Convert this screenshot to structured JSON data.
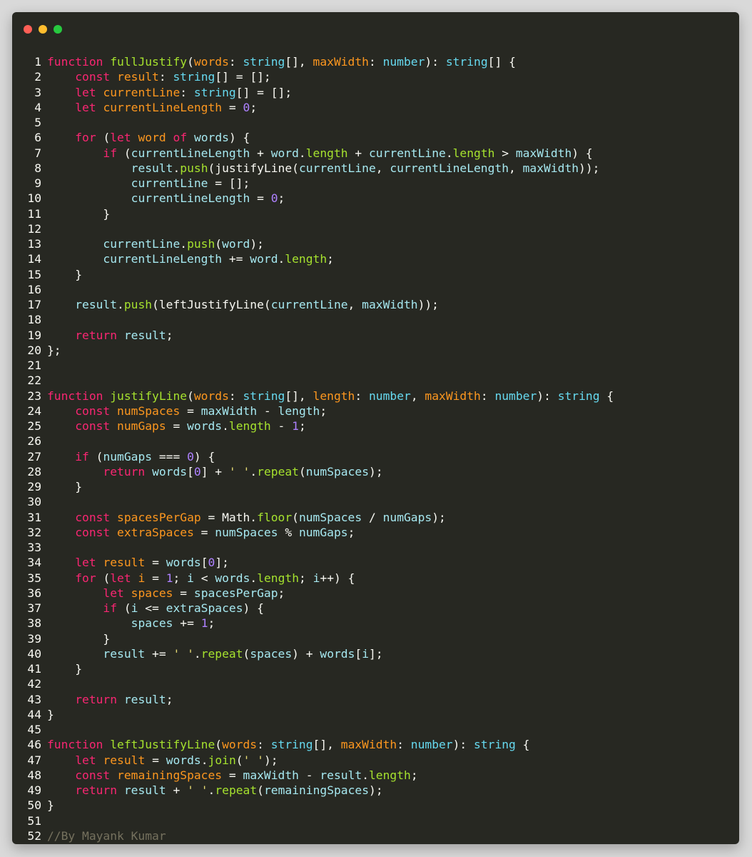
{
  "window": {
    "controls": {
      "close_color": "#ff5f56",
      "minimize_color": "#ffbd2e",
      "maximize_color": "#27c93f"
    }
  },
  "code": {
    "language": "typescript",
    "lines": [
      {
        "n": "1",
        "tokens": [
          [
            "function",
            "k"
          ],
          [
            " "
          ],
          [
            "fullJustify",
            "fn"
          ],
          [
            "("
          ],
          [
            "words",
            "p"
          ],
          [
            ": "
          ],
          [
            "string",
            "t"
          ],
          [
            "[], "
          ],
          [
            "maxWidth",
            "p"
          ],
          [
            ": "
          ],
          [
            "number",
            "t"
          ],
          [
            "): "
          ],
          [
            "string",
            "t"
          ],
          [
            "[] {"
          ]
        ]
      },
      {
        "n": "2",
        "tokens": [
          [
            "    "
          ],
          [
            "const",
            "k"
          ],
          [
            " "
          ],
          [
            "result",
            "p"
          ],
          [
            ": "
          ],
          [
            "string",
            "t"
          ],
          [
            "[] = [];"
          ]
        ]
      },
      {
        "n": "3",
        "tokens": [
          [
            "    "
          ],
          [
            "let",
            "k"
          ],
          [
            " "
          ],
          [
            "currentLine",
            "p"
          ],
          [
            ": "
          ],
          [
            "string",
            "t"
          ],
          [
            "[] = [];"
          ]
        ]
      },
      {
        "n": "4",
        "tokens": [
          [
            "    "
          ],
          [
            "let",
            "k"
          ],
          [
            " "
          ],
          [
            "currentLineLength",
            "p"
          ],
          [
            " = "
          ],
          [
            "0",
            "n"
          ],
          [
            ";"
          ]
        ]
      },
      {
        "n": "5",
        "tokens": []
      },
      {
        "n": "6",
        "tokens": [
          [
            "    "
          ],
          [
            "for",
            "k"
          ],
          [
            " ("
          ],
          [
            "let",
            "k"
          ],
          [
            " "
          ],
          [
            "word",
            "p"
          ],
          [
            " "
          ],
          [
            "of",
            "k"
          ],
          [
            " "
          ],
          [
            "words",
            "v"
          ],
          [
            ") {"
          ]
        ]
      },
      {
        "n": "7",
        "tokens": [
          [
            "        "
          ],
          [
            "if",
            "k"
          ],
          [
            " ("
          ],
          [
            "currentLineLength",
            "v"
          ],
          [
            " + "
          ],
          [
            "word",
            "v"
          ],
          [
            "."
          ],
          [
            "length",
            "fn"
          ],
          [
            " + "
          ],
          [
            "currentLine",
            "v"
          ],
          [
            "."
          ],
          [
            "length",
            "fn"
          ],
          [
            " > "
          ],
          [
            "maxWidth",
            "v"
          ],
          [
            ") {"
          ]
        ]
      },
      {
        "n": "8",
        "tokens": [
          [
            "            "
          ],
          [
            "result",
            "v"
          ],
          [
            "."
          ],
          [
            "push",
            "fn"
          ],
          [
            "(justifyLine("
          ],
          [
            "currentLine",
            "v"
          ],
          [
            ", "
          ],
          [
            "currentLineLength",
            "v"
          ],
          [
            ", "
          ],
          [
            "maxWidth",
            "v"
          ],
          [
            "));"
          ]
        ]
      },
      {
        "n": "9",
        "tokens": [
          [
            "            "
          ],
          [
            "currentLine",
            "v"
          ],
          [
            " = [];"
          ]
        ]
      },
      {
        "n": "10",
        "tokens": [
          [
            "            "
          ],
          [
            "currentLineLength",
            "v"
          ],
          [
            " = "
          ],
          [
            "0",
            "n"
          ],
          [
            ";"
          ]
        ]
      },
      {
        "n": "11",
        "tokens": [
          [
            "        }"
          ]
        ]
      },
      {
        "n": "12",
        "tokens": []
      },
      {
        "n": "13",
        "tokens": [
          [
            "        "
          ],
          [
            "currentLine",
            "v"
          ],
          [
            "."
          ],
          [
            "push",
            "fn"
          ],
          [
            "("
          ],
          [
            "word",
            "v"
          ],
          [
            ");"
          ]
        ]
      },
      {
        "n": "14",
        "tokens": [
          [
            "        "
          ],
          [
            "currentLineLength",
            "v"
          ],
          [
            " += "
          ],
          [
            "word",
            "v"
          ],
          [
            "."
          ],
          [
            "length",
            "fn"
          ],
          [
            ";"
          ]
        ]
      },
      {
        "n": "15",
        "tokens": [
          [
            "    }"
          ]
        ]
      },
      {
        "n": "16",
        "tokens": []
      },
      {
        "n": "17",
        "tokens": [
          [
            "    "
          ],
          [
            "result",
            "v"
          ],
          [
            "."
          ],
          [
            "push",
            "fn"
          ],
          [
            "(leftJustifyLine("
          ],
          [
            "currentLine",
            "v"
          ],
          [
            ", "
          ],
          [
            "maxWidth",
            "v"
          ],
          [
            "));"
          ]
        ]
      },
      {
        "n": "18",
        "tokens": []
      },
      {
        "n": "19",
        "tokens": [
          [
            "    "
          ],
          [
            "return",
            "k"
          ],
          [
            " "
          ],
          [
            "result",
            "v"
          ],
          [
            ";"
          ]
        ]
      },
      {
        "n": "20",
        "tokens": [
          [
            "};"
          ]
        ]
      },
      {
        "n": "21",
        "tokens": []
      },
      {
        "n": "22",
        "tokens": []
      },
      {
        "n": "23",
        "tokens": [
          [
            "function",
            "k"
          ],
          [
            " "
          ],
          [
            "justifyLine",
            "fn"
          ],
          [
            "("
          ],
          [
            "words",
            "p"
          ],
          [
            ": "
          ],
          [
            "string",
            "t"
          ],
          [
            "[], "
          ],
          [
            "length",
            "p"
          ],
          [
            ": "
          ],
          [
            "number",
            "t"
          ],
          [
            ", "
          ],
          [
            "maxWidth",
            "p"
          ],
          [
            ": "
          ],
          [
            "number",
            "t"
          ],
          [
            "): "
          ],
          [
            "string",
            "t"
          ],
          [
            " {"
          ]
        ]
      },
      {
        "n": "24",
        "tokens": [
          [
            "    "
          ],
          [
            "const",
            "k"
          ],
          [
            " "
          ],
          [
            "numSpaces",
            "p"
          ],
          [
            " = "
          ],
          [
            "maxWidth",
            "v"
          ],
          [
            " - "
          ],
          [
            "length",
            "v"
          ],
          [
            ";"
          ]
        ]
      },
      {
        "n": "25",
        "tokens": [
          [
            "    "
          ],
          [
            "const",
            "k"
          ],
          [
            " "
          ],
          [
            "numGaps",
            "p"
          ],
          [
            " = "
          ],
          [
            "words",
            "v"
          ],
          [
            "."
          ],
          [
            "length",
            "fn"
          ],
          [
            " - "
          ],
          [
            "1",
            "n"
          ],
          [
            ";"
          ]
        ]
      },
      {
        "n": "26",
        "tokens": []
      },
      {
        "n": "27",
        "tokens": [
          [
            "    "
          ],
          [
            "if",
            "k"
          ],
          [
            " ("
          ],
          [
            "numGaps",
            "v"
          ],
          [
            " === "
          ],
          [
            "0",
            "n"
          ],
          [
            ") {"
          ]
        ]
      },
      {
        "n": "28",
        "tokens": [
          [
            "        "
          ],
          [
            "return",
            "k"
          ],
          [
            " "
          ],
          [
            "words",
            "v"
          ],
          [
            "["
          ],
          [
            "0",
            "n"
          ],
          [
            "] + "
          ],
          [
            "' '",
            "s"
          ],
          [
            "."
          ],
          [
            "repeat",
            "fn"
          ],
          [
            "("
          ],
          [
            "numSpaces",
            "v"
          ],
          [
            ");"
          ]
        ]
      },
      {
        "n": "29",
        "tokens": [
          [
            "    }"
          ]
        ]
      },
      {
        "n": "30",
        "tokens": []
      },
      {
        "n": "31",
        "tokens": [
          [
            "    "
          ],
          [
            "const",
            "k"
          ],
          [
            " "
          ],
          [
            "spacesPerGap",
            "p"
          ],
          [
            " = Math."
          ],
          [
            "floor",
            "fn"
          ],
          [
            "("
          ],
          [
            "numSpaces",
            "v"
          ],
          [
            " / "
          ],
          [
            "numGaps",
            "v"
          ],
          [
            ");"
          ]
        ]
      },
      {
        "n": "32",
        "tokens": [
          [
            "    "
          ],
          [
            "const",
            "k"
          ],
          [
            " "
          ],
          [
            "extraSpaces",
            "p"
          ],
          [
            " = "
          ],
          [
            "numSpaces",
            "v"
          ],
          [
            " % "
          ],
          [
            "numGaps",
            "v"
          ],
          [
            ";"
          ]
        ]
      },
      {
        "n": "33",
        "tokens": []
      },
      {
        "n": "34",
        "tokens": [
          [
            "    "
          ],
          [
            "let",
            "k"
          ],
          [
            " "
          ],
          [
            "result",
            "p"
          ],
          [
            " = "
          ],
          [
            "words",
            "v"
          ],
          [
            "["
          ],
          [
            "0",
            "n"
          ],
          [
            "];"
          ]
        ]
      },
      {
        "n": "35",
        "tokens": [
          [
            "    "
          ],
          [
            "for",
            "k"
          ],
          [
            " ("
          ],
          [
            "let",
            "k"
          ],
          [
            " "
          ],
          [
            "i",
            "p"
          ],
          [
            " = "
          ],
          [
            "1",
            "n"
          ],
          [
            "; "
          ],
          [
            "i",
            "v"
          ],
          [
            " < "
          ],
          [
            "words",
            "v"
          ],
          [
            "."
          ],
          [
            "length",
            "fn"
          ],
          [
            "; "
          ],
          [
            "i",
            "v"
          ],
          [
            "++) {"
          ]
        ]
      },
      {
        "n": "36",
        "tokens": [
          [
            "        "
          ],
          [
            "let",
            "k"
          ],
          [
            " "
          ],
          [
            "spaces",
            "p"
          ],
          [
            " = "
          ],
          [
            "spacesPerGap",
            "v"
          ],
          [
            ";"
          ]
        ]
      },
      {
        "n": "37",
        "tokens": [
          [
            "        "
          ],
          [
            "if",
            "k"
          ],
          [
            " ("
          ],
          [
            "i",
            "v"
          ],
          [
            " <= "
          ],
          [
            "extraSpaces",
            "v"
          ],
          [
            ") {"
          ]
        ]
      },
      {
        "n": "38",
        "tokens": [
          [
            "            "
          ],
          [
            "spaces",
            "v"
          ],
          [
            " += "
          ],
          [
            "1",
            "n"
          ],
          [
            ";"
          ]
        ]
      },
      {
        "n": "39",
        "tokens": [
          [
            "        }"
          ]
        ]
      },
      {
        "n": "40",
        "tokens": [
          [
            "        "
          ],
          [
            "result",
            "v"
          ],
          [
            " += "
          ],
          [
            "' '",
            "s"
          ],
          [
            "."
          ],
          [
            "repeat",
            "fn"
          ],
          [
            "("
          ],
          [
            "spaces",
            "v"
          ],
          [
            ") + "
          ],
          [
            "words",
            "v"
          ],
          [
            "["
          ],
          [
            "i",
            "v"
          ],
          [
            "];"
          ]
        ]
      },
      {
        "n": "41",
        "tokens": [
          [
            "    }"
          ]
        ]
      },
      {
        "n": "42",
        "tokens": []
      },
      {
        "n": "43",
        "tokens": [
          [
            "    "
          ],
          [
            "return",
            "k"
          ],
          [
            " "
          ],
          [
            "result",
            "v"
          ],
          [
            ";"
          ]
        ]
      },
      {
        "n": "44",
        "tokens": [
          [
            "}"
          ]
        ]
      },
      {
        "n": "45",
        "tokens": []
      },
      {
        "n": "46",
        "tokens": [
          [
            "function",
            "k"
          ],
          [
            " "
          ],
          [
            "leftJustifyLine",
            "fn"
          ],
          [
            "("
          ],
          [
            "words",
            "p"
          ],
          [
            ": "
          ],
          [
            "string",
            "t"
          ],
          [
            "[], "
          ],
          [
            "maxWidth",
            "p"
          ],
          [
            ": "
          ],
          [
            "number",
            "t"
          ],
          [
            "): "
          ],
          [
            "string",
            "t"
          ],
          [
            " {"
          ]
        ]
      },
      {
        "n": "47",
        "tokens": [
          [
            "    "
          ],
          [
            "let",
            "k"
          ],
          [
            " "
          ],
          [
            "result",
            "p"
          ],
          [
            " = "
          ],
          [
            "words",
            "v"
          ],
          [
            "."
          ],
          [
            "join",
            "fn"
          ],
          [
            "("
          ],
          [
            "' '",
            "s"
          ],
          [
            ");"
          ]
        ]
      },
      {
        "n": "48",
        "tokens": [
          [
            "    "
          ],
          [
            "const",
            "k"
          ],
          [
            " "
          ],
          [
            "remainingSpaces",
            "p"
          ],
          [
            " = "
          ],
          [
            "maxWidth",
            "v"
          ],
          [
            " - "
          ],
          [
            "result",
            "v"
          ],
          [
            "."
          ],
          [
            "length",
            "fn"
          ],
          [
            ";"
          ]
        ]
      },
      {
        "n": "49",
        "tokens": [
          [
            "    "
          ],
          [
            "return",
            "k"
          ],
          [
            " "
          ],
          [
            "result",
            "v"
          ],
          [
            " + "
          ],
          [
            "' '",
            "s"
          ],
          [
            "."
          ],
          [
            "repeat",
            "fn"
          ],
          [
            "("
          ],
          [
            "remainingSpaces",
            "v"
          ],
          [
            ");"
          ]
        ]
      },
      {
        "n": "50",
        "tokens": [
          [
            "}"
          ]
        ]
      },
      {
        "n": "51",
        "tokens": []
      },
      {
        "n": "52",
        "tokens": [
          [
            "//By Mayank Kumar",
            "c"
          ]
        ]
      }
    ]
  }
}
